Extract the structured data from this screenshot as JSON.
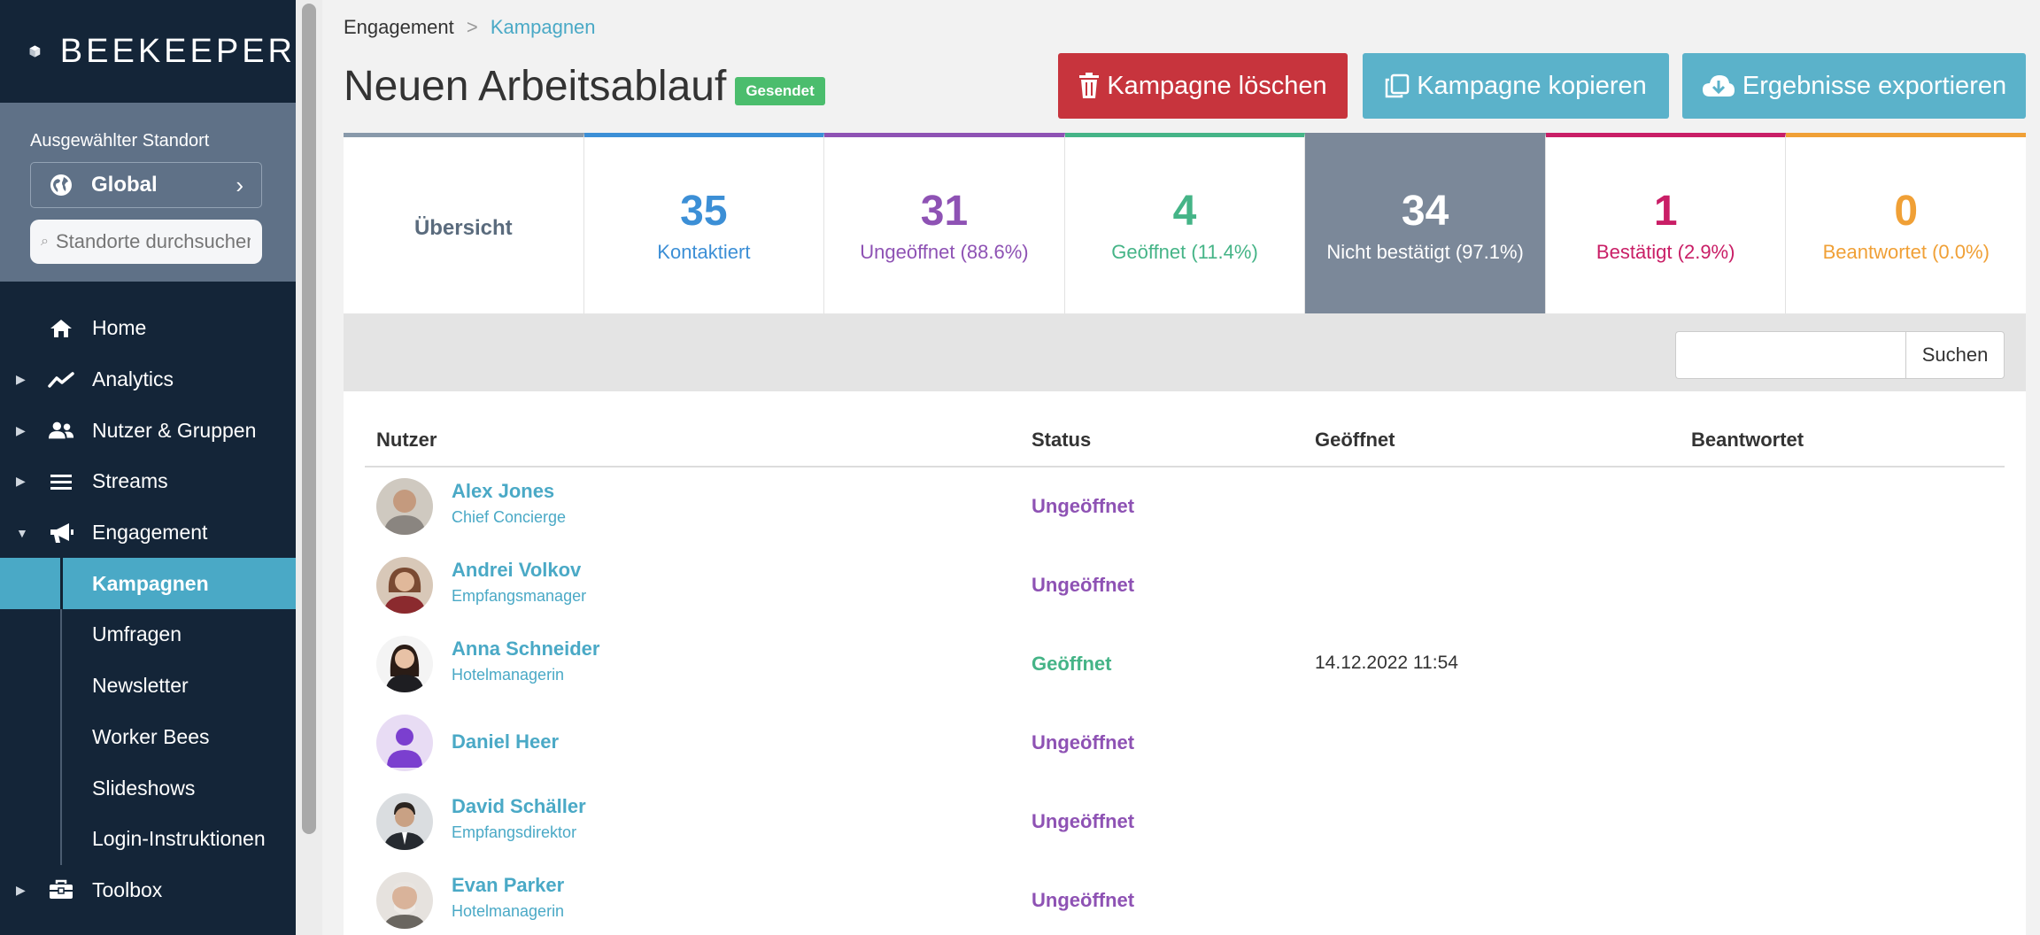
{
  "brand": {
    "name": "BEEKEEPER"
  },
  "location": {
    "label": "Ausgewählter Standort",
    "selected": "Global",
    "search_placeholder": "Standorte durchsuchen"
  },
  "nav": {
    "items": [
      {
        "label": "Home",
        "icon": "home-icon"
      },
      {
        "label": "Analytics",
        "icon": "chart-line-icon"
      },
      {
        "label": "Nutzer & Gruppen",
        "icon": "users-icon"
      },
      {
        "label": "Streams",
        "icon": "list-icon"
      },
      {
        "label": "Engagement",
        "icon": "megaphone-icon"
      }
    ],
    "engagement_sub": [
      "Kampagnen",
      "Umfragen",
      "Newsletter",
      "Worker Bees",
      "Slideshows",
      "Login-Instruktionen"
    ],
    "toolbox": {
      "label": "Toolbox",
      "icon": "toolbox-icon"
    }
  },
  "breadcrumb": {
    "parent": "Engagement",
    "separator": ">",
    "current": "Kampagnen"
  },
  "page": {
    "title": "Neuen Arbeitsablauf",
    "badge": "Gesendet"
  },
  "actions": {
    "delete": "Kampagne löschen",
    "copy": "Kampagne kopieren",
    "export": "Ergebnisse exportieren"
  },
  "stats": {
    "overview": "Übersicht",
    "contacted": {
      "value": "35",
      "label": "Kontaktiert"
    },
    "unopened": {
      "value": "31",
      "label": "Ungeöffnet (88.6%)"
    },
    "opened": {
      "value": "4",
      "label": "Geöffnet (11.4%)"
    },
    "unconfirmed": {
      "value": "34",
      "label": "Nicht bestätigt (97.1%)"
    },
    "confirmed": {
      "value": "1",
      "label": "Bestätigt (2.9%)"
    },
    "answered": {
      "value": "0",
      "label": "Beantwortet (0.0%)"
    }
  },
  "colors": {
    "contacted": "#3c8fd6",
    "unopened": "#8e52b4",
    "opened": "#45b487",
    "unconfirmed": "#7b8899",
    "confirmed": "#c91e66",
    "answered": "#f0a036",
    "danger": "#c7343d",
    "info": "#5bb2ca",
    "badge": "#4bbd6d",
    "sidebar": "#142538",
    "sidebar_active": "#4aa9c6"
  },
  "search": {
    "button": "Suchen",
    "value": ""
  },
  "table": {
    "headers": {
      "user": "Nutzer",
      "status": "Status",
      "opened": "Geöffnet",
      "answered": "Beantwortet"
    },
    "rows": [
      {
        "name": "Alex Jones",
        "role": "Chief Concierge",
        "status": "Ungeöffnet",
        "opened": ""
      },
      {
        "name": "Andrei Volkov",
        "role": "Empfangsmanager",
        "status": "Ungeöffnet",
        "opened": ""
      },
      {
        "name": "Anna Schneider",
        "role": "Hotelmanagerin",
        "status": "Geöffnet",
        "opened": "14.12.2022 11:54"
      },
      {
        "name": "Daniel Heer",
        "role": "",
        "status": "Ungeöffnet",
        "opened": ""
      },
      {
        "name": "David Schäller",
        "role": "Empfangsdirektor",
        "status": "Ungeöffnet",
        "opened": ""
      },
      {
        "name": "Evan Parker",
        "role": "Hotelmanagerin",
        "status": "Ungeöffnet",
        "opened": ""
      }
    ]
  }
}
